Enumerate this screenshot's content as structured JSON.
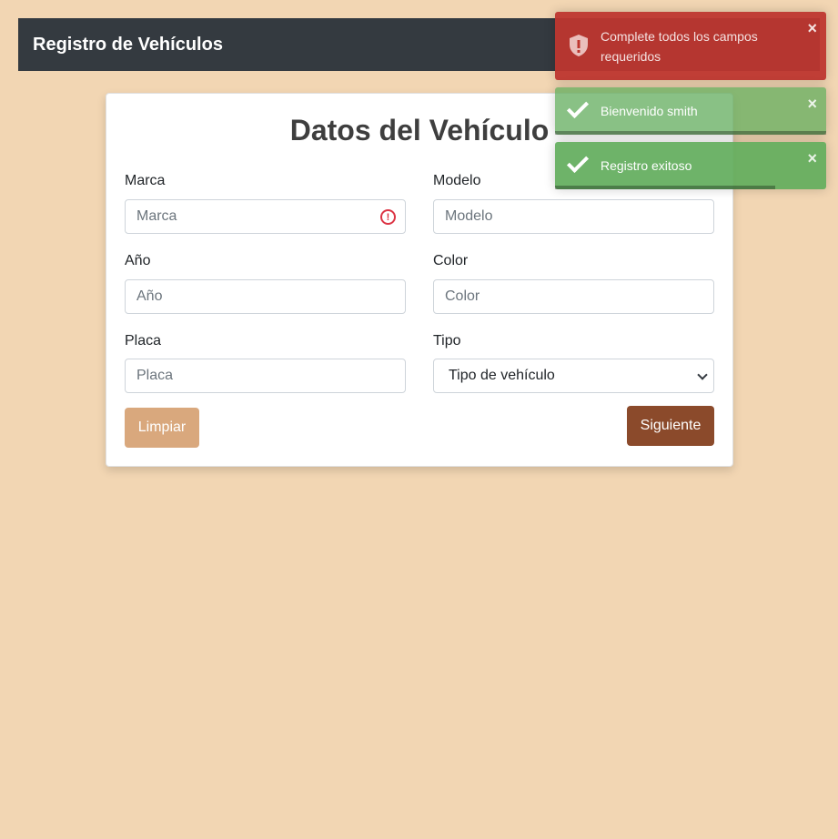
{
  "navbar": {
    "brand": "Registro de Vehículos"
  },
  "form": {
    "title": "Datos del Vehículo",
    "marca": {
      "label": "Marca",
      "placeholder": "Marca"
    },
    "modelo": {
      "label": "Modelo",
      "placeholder": "Modelo"
    },
    "anio": {
      "label": "Año",
      "placeholder": "Año"
    },
    "color": {
      "label": "Color",
      "placeholder": "Color"
    },
    "placa": {
      "label": "Placa",
      "placeholder": "Placa"
    },
    "tipo": {
      "label": "Tipo",
      "selected": "Tipo de vehículo"
    },
    "clear_label": "Limpiar",
    "next_label": "Siguiente"
  },
  "toasts": [
    {
      "type": "error",
      "message": "Complete todos los campos requeridos",
      "close": "×"
    },
    {
      "type": "success",
      "message": "Bienvenido smith",
      "close": "×"
    },
    {
      "type": "success",
      "message": "Registro exitoso",
      "close": "×"
    }
  ],
  "colors": {
    "background": "#f2d6b3",
    "navbar": "#343a40",
    "clear_button": "#d9a87d",
    "next_button": "#8b4a2b",
    "error_toast": "#bd362f",
    "success_toast": "#62ac5c"
  }
}
